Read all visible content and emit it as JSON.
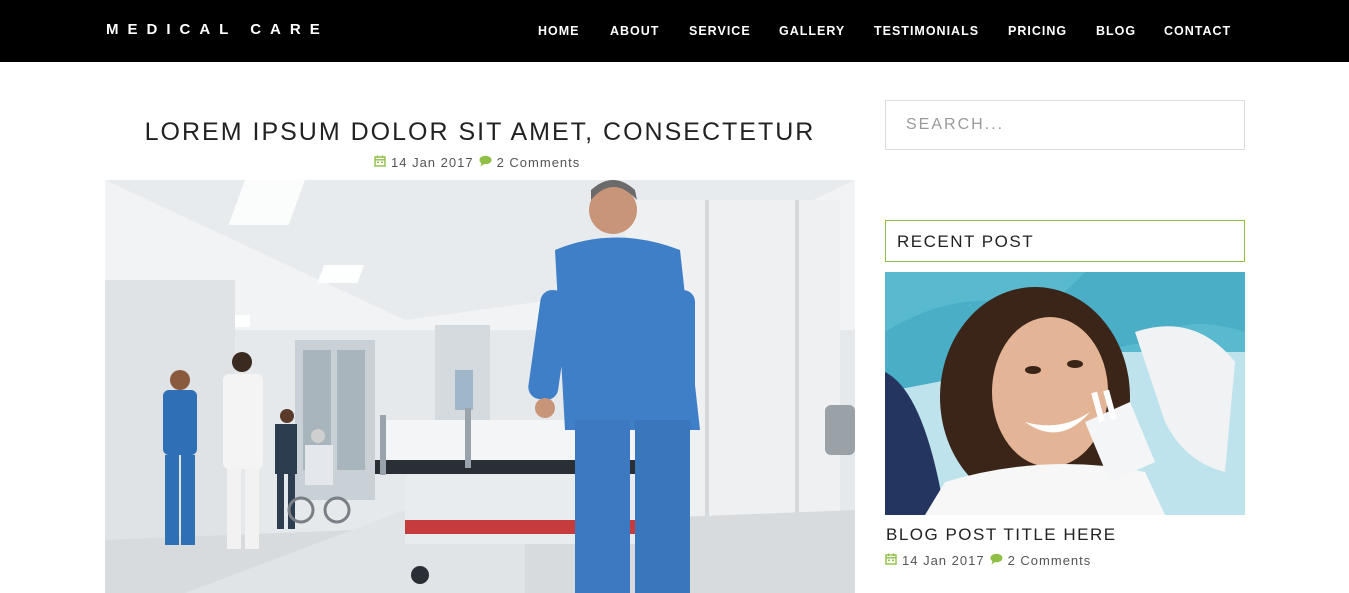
{
  "brand": "MEDICAL CARE",
  "nav": [
    {
      "label": "HOME"
    },
    {
      "label": "ABOUT"
    },
    {
      "label": "SERVICE"
    },
    {
      "label": "GALLERY"
    },
    {
      "label": "TESTIMONIALS"
    },
    {
      "label": "PRICING"
    },
    {
      "label": "BLOG"
    },
    {
      "label": "CONTACT"
    }
  ],
  "article": {
    "title": "LOREM IPSUM DOLOR SIT AMET, CONSECTETUR",
    "date": "14 Jan 2017",
    "comments": "2 Comments",
    "image": "hospital-corridor-photo"
  },
  "sidebar": {
    "search_placeholder": "SEARCH...",
    "recent_heading": "RECENT POST",
    "post": {
      "image": "dental-patient-photo",
      "title": "BLOG POST TITLE HERE",
      "date": "14 Jan 2017",
      "comments": "2 Comments"
    }
  },
  "colors": {
    "nav_bg": "#000000",
    "accent_green": "#8fbf45",
    "text_dark": "#222222"
  },
  "icons": {
    "date": "calendar-icon",
    "comments": "comment-icon"
  }
}
